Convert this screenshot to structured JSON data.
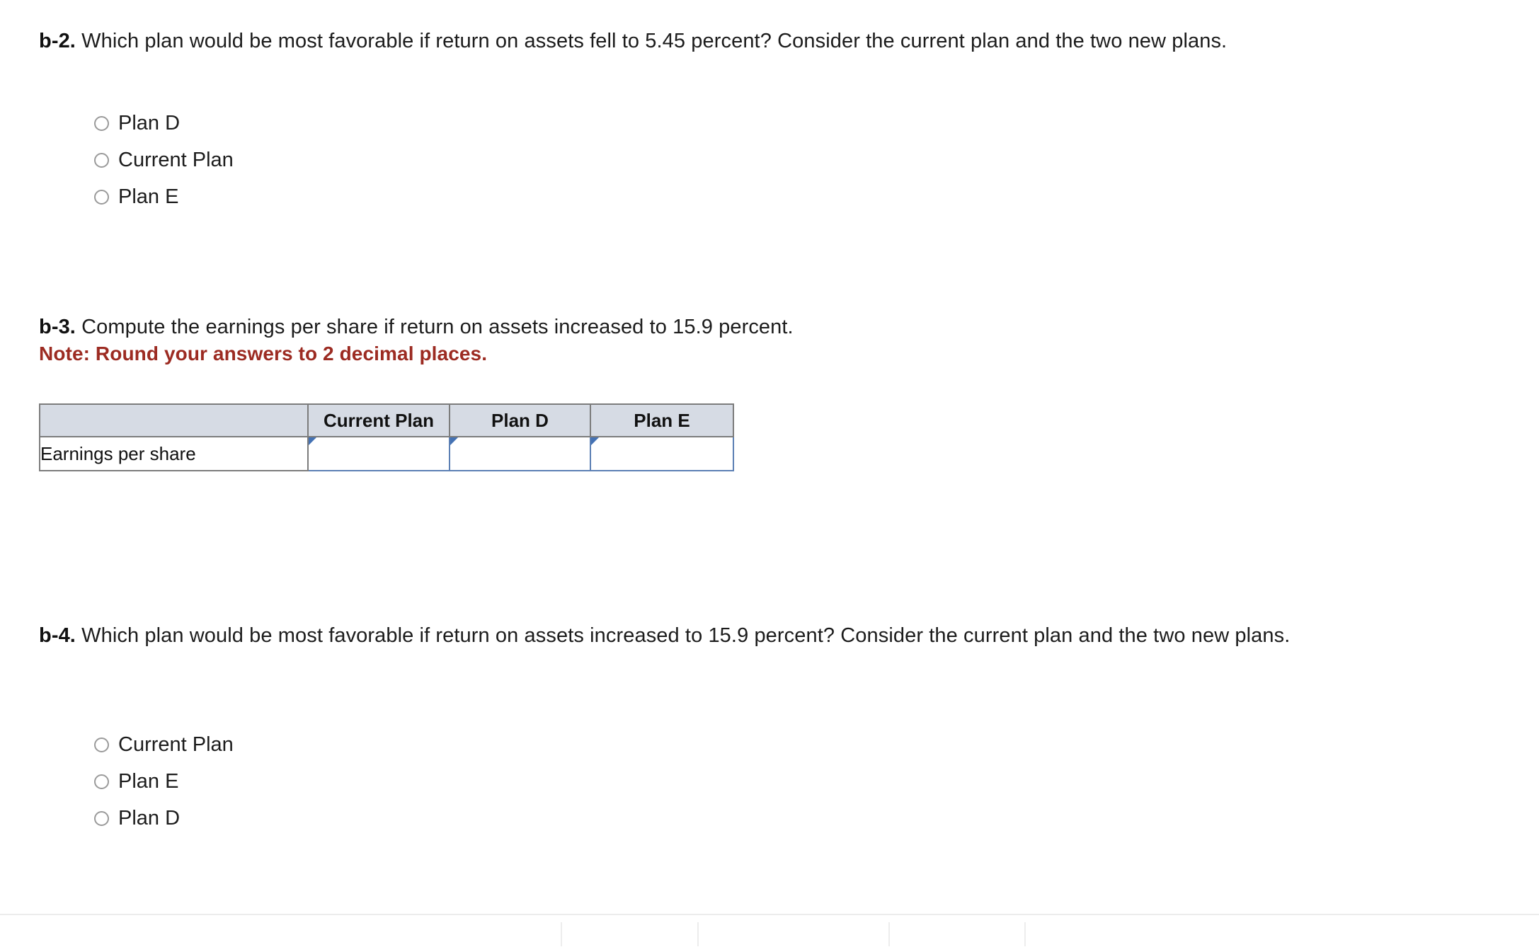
{
  "sections": {
    "b2": {
      "label": "b-2.",
      "text": "Which plan would be most favorable if return on assets fell to 5.45 percent? Consider the current plan and the two new plans.",
      "options": [
        {
          "label": "Plan D",
          "selected": false
        },
        {
          "label": "Current Plan",
          "selected": false
        },
        {
          "label": "Plan E",
          "selected": false
        }
      ]
    },
    "b3": {
      "label": "b-3.",
      "text": "Compute the earnings per share if return on assets increased to 15.9 percent.",
      "note": "Note: Round your answers to 2 decimal places.",
      "table": {
        "headers": [
          "",
          "Current Plan",
          "Plan D",
          "Plan E"
        ],
        "rows": [
          {
            "label": "Earnings per share",
            "values": [
              "",
              "",
              ""
            ],
            "placeholders": [
              "",
              "",
              ""
            ]
          }
        ]
      }
    },
    "b4": {
      "label": "b-4.",
      "text": "Which plan would be most favorable if return on assets increased to 15.9 percent? Consider the current plan and the two new plans.",
      "options": [
        {
          "label": "Current Plan",
          "selected": false
        },
        {
          "label": "Plan E",
          "selected": false
        },
        {
          "label": "Plan D",
          "selected": false
        }
      ]
    }
  },
  "colors": {
    "note_red": "#9c2b22",
    "table_header_bg": "#d6dbe4",
    "table_border": "#7c7c7c",
    "input_border": "#5b7fb4",
    "input_flag": "#4472b4"
  }
}
